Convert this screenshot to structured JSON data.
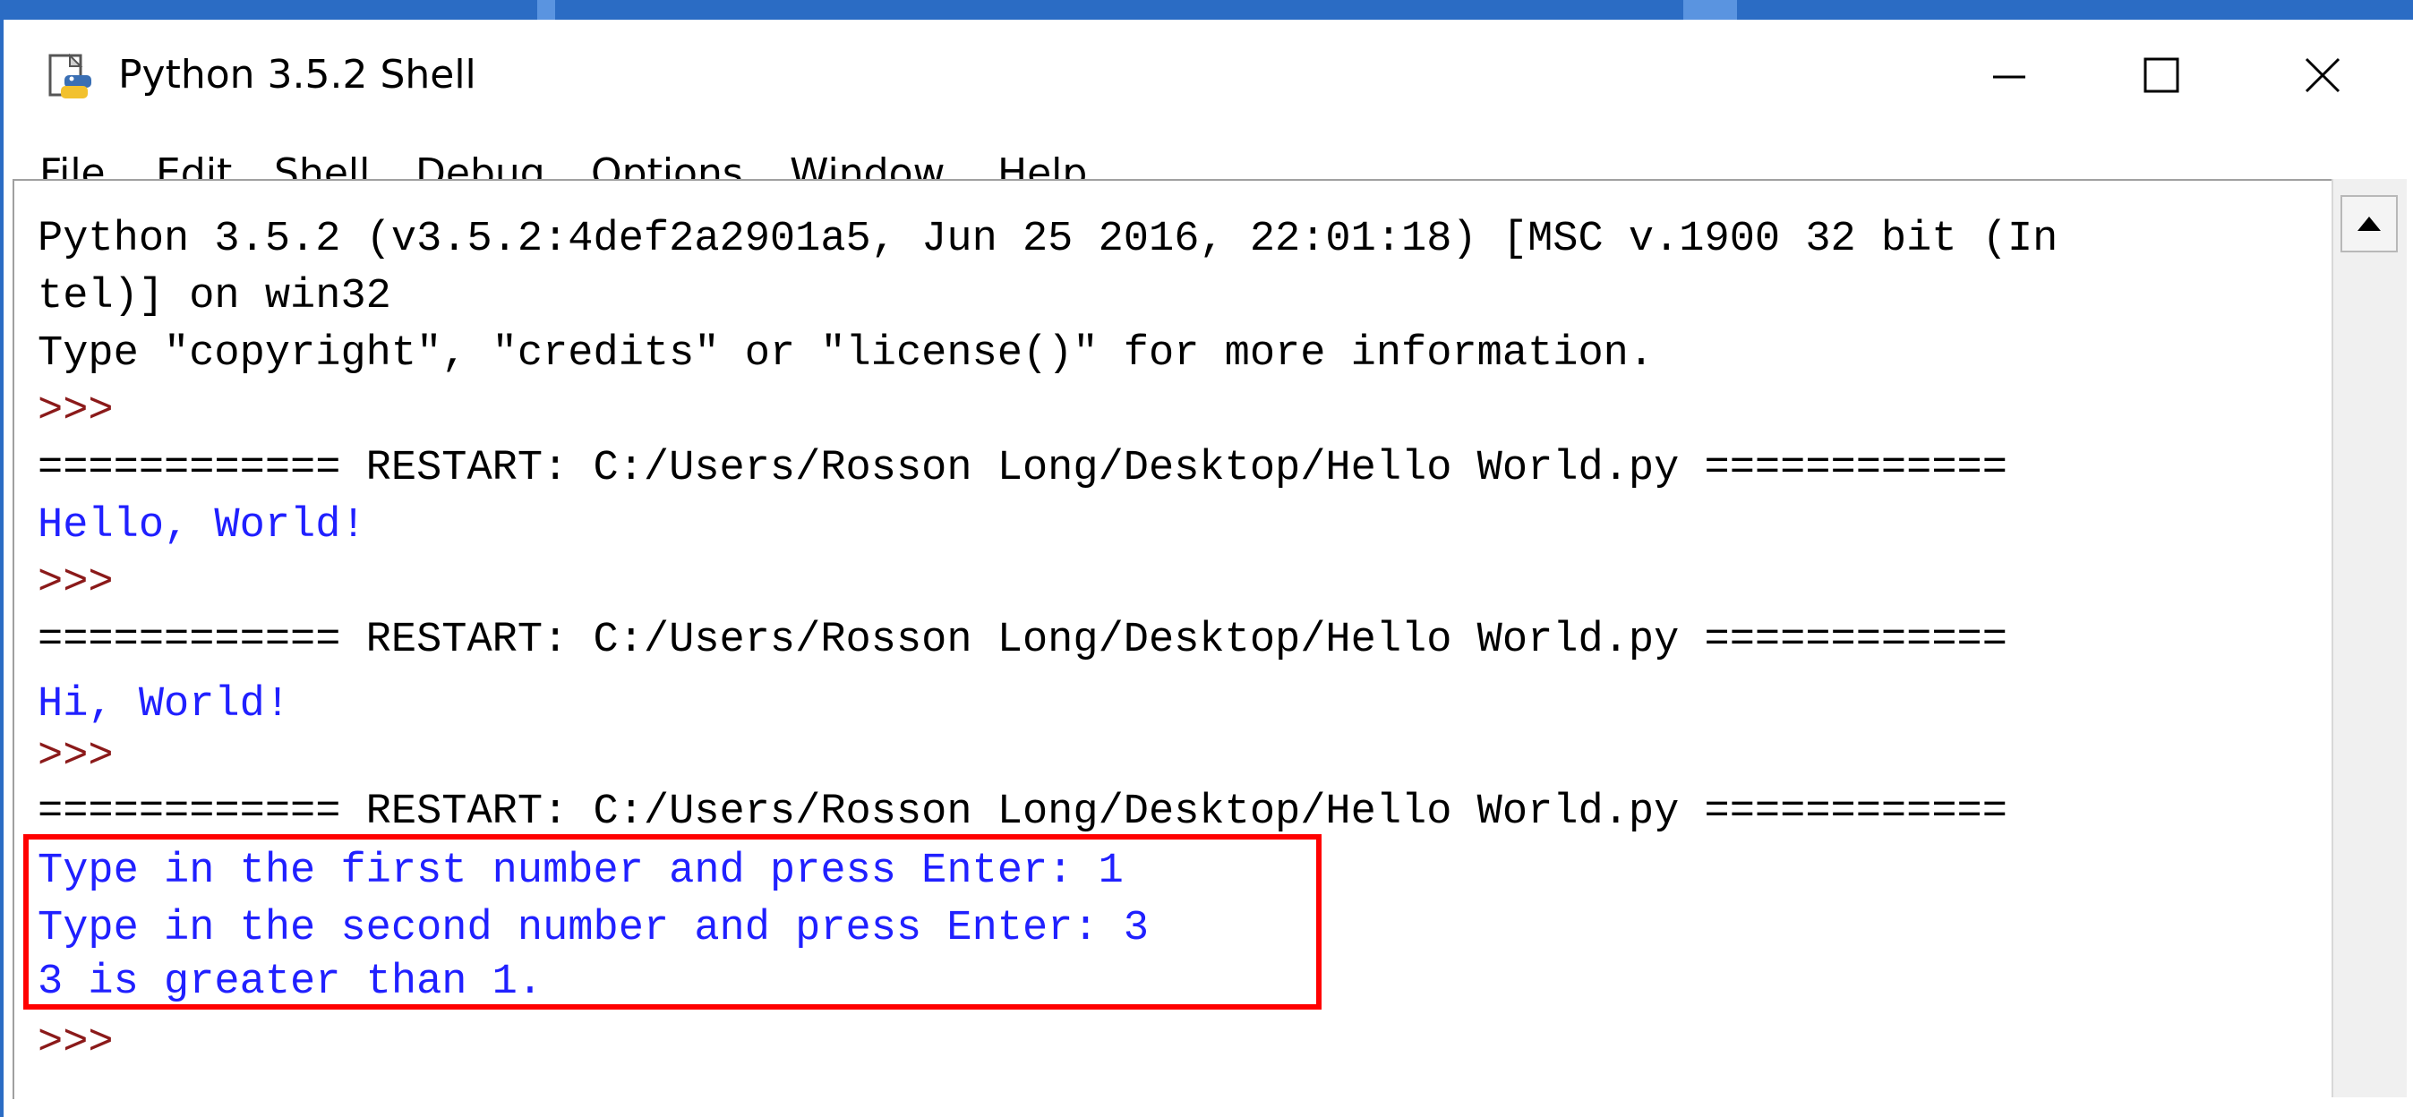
{
  "window": {
    "title": "Python 3.5.2 Shell",
    "controls": {
      "minimize_icon": "minimize-icon",
      "maximize_icon": "maximize-icon",
      "close_icon": "close-icon"
    }
  },
  "menubar": {
    "items": [
      "File",
      "Edit",
      "Shell",
      "Debug",
      "Options",
      "Window",
      "Help"
    ]
  },
  "shell": {
    "lines": [
      {
        "text": "Python 3.5.2 (v3.5.2:4def2a2901a5, Jun 25 2016, 22:01:18) [MSC v.1900 32 bit (In",
        "color": "black"
      },
      {
        "text": "tel)] on win32",
        "color": "black"
      },
      {
        "text": "Type \"copyright\", \"credits\" or \"license()\" for more information.",
        "color": "black"
      },
      {
        "text": ">>> ",
        "color": "prompt"
      },
      {
        "text": "============ RESTART: C:/Users/Rosson Long/Desktop/Hello World.py ============",
        "color": "black"
      },
      {
        "text": "Hello, World!",
        "color": "blue"
      },
      {
        "text": ">>> ",
        "color": "prompt"
      },
      {
        "text": "============ RESTART: C:/Users/Rosson Long/Desktop/Hello World.py ============",
        "color": "black"
      },
      {
        "text": "Hi, World!",
        "color": "blue"
      },
      {
        "text": ">>> ",
        "color": "prompt"
      },
      {
        "text": "============ RESTART: C:/Users/Rosson Long/Desktop/Hello World.py ============",
        "color": "black"
      },
      {
        "text": "Type in the first number and press Enter: 1",
        "color": "blue"
      },
      {
        "text": "Type in the second number and press Enter: 3",
        "color": "blue"
      },
      {
        "text": "3 is greater than 1.",
        "color": "blue"
      },
      {
        "text": ">>> ",
        "color": "prompt"
      }
    ]
  },
  "colors": {
    "output_blue": "#2020ff",
    "prompt_red": "#8b1a1a",
    "highlight_red": "#ff0000",
    "titlebar_blue": "#2b6cc4"
  }
}
